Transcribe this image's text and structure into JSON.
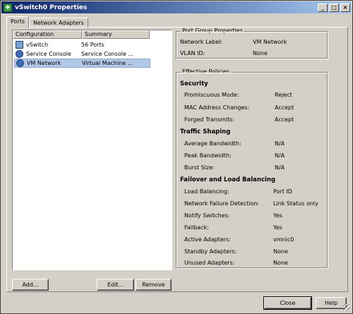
{
  "window": {
    "title": "vSwitch0 Properties"
  },
  "tabs": [
    {
      "label": "Ports"
    },
    {
      "label": "Network Adapters"
    }
  ],
  "list": {
    "columns": [
      "Configuration",
      "Summary"
    ],
    "rows": [
      {
        "icon": "switch-icon",
        "config": "vSwitch",
        "summary": "56 Ports"
      },
      {
        "icon": "console-icon",
        "config": "Service Console",
        "summary": "Service Console ..."
      },
      {
        "icon": "vm-network-icon",
        "config": "VM Network",
        "summary": "Virtual Machine ...",
        "selected": true
      }
    ]
  },
  "port_group": {
    "title": "Port Group Properties",
    "network_label": {
      "label": "Network Label:",
      "value": "VM Network"
    },
    "vlan_id": {
      "label": "VLAN ID:",
      "value": "None"
    }
  },
  "policies": {
    "title": "Effective Policies",
    "security": {
      "heading": "Security",
      "promiscuous": {
        "label": "Promiscuous Mode:",
        "value": "Reject"
      },
      "mac_changes": {
        "label": "MAC Address Changes:",
        "value": "Accept"
      },
      "forged": {
        "label": "Forged Transmits:",
        "value": "Accept"
      }
    },
    "traffic": {
      "heading": "Traffic Shaping",
      "avg": {
        "label": "Average Bandwidth:",
        "value": "N/A"
      },
      "peak": {
        "label": "Peak Bandwidth:",
        "value": "N/A"
      },
      "burst": {
        "label": "Burst Size:",
        "value": "N/A"
      }
    },
    "failover": {
      "heading": "Failover and Load Balancing",
      "load_balancing": {
        "label": "Load Balancing:",
        "value": "Port ID"
      },
      "failure_detection": {
        "label": "Network Failure Detection:",
        "value": "Link Status only"
      },
      "notify": {
        "label": "Notify Switches:",
        "value": "Yes"
      },
      "failback": {
        "label": "Failback:",
        "value": "Yes"
      },
      "active": {
        "label": "Active Adapters:",
        "value": "vmnic0"
      },
      "standby": {
        "label": "Standby Adapters:",
        "value": "None"
      },
      "unused": {
        "label": "Unused Adapters:",
        "value": "None"
      }
    }
  },
  "buttons": {
    "add": "Add...",
    "edit": "Edit...",
    "remove": "Remove",
    "close": "Close",
    "help": "Help"
  },
  "titlebar_buttons": {
    "minimize": "_",
    "maximize": "□",
    "close": "×"
  }
}
